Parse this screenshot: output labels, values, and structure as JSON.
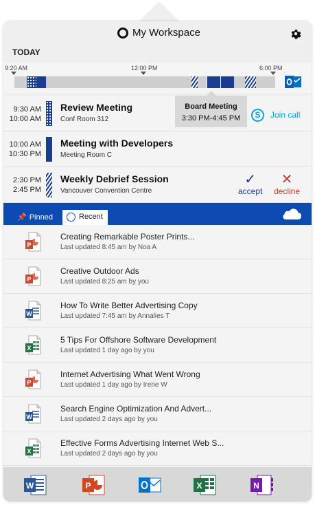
{
  "header": {
    "title": "My Workspace"
  },
  "today_label": "TODAY",
  "timeline": {
    "start_label": "9:20 AM",
    "mid_label": "12:00 PM",
    "end_label": "6:00 PM"
  },
  "meetings": [
    {
      "start": "9:30 AM",
      "end": "10:00 AM",
      "title": "Review Meeting",
      "location": "Conf Room 312",
      "pattern": "dots"
    },
    {
      "start": "10:00 AM",
      "end": "10:30 PM",
      "title": "Meeting with Developers",
      "location": "Meeting Room C",
      "pattern": "solid"
    },
    {
      "start": "2:30 PM",
      "end": "2:45 PM",
      "title": "Weekly Debrief Session",
      "location": "Vancouver Convention Centre",
      "pattern": "stripes"
    }
  ],
  "tooltip": {
    "title": "Board Meeting",
    "time": "3:30 PM-4:45 PM"
  },
  "join_call": {
    "label": "Join call",
    "icon": "skype-icon"
  },
  "rsvp": {
    "accept_label": "accept",
    "decline_label": "decline",
    "accept_color": "#1a3d8f",
    "decline_color": "#c0392b"
  },
  "tabs": {
    "pinned_label": "Pinned",
    "recent_label": "Recent"
  },
  "files": [
    {
      "app": "powerpoint",
      "title": "Creating Remarkable Poster Prints...",
      "meta": "Last updated 8:45 am by Noa A"
    },
    {
      "app": "powerpoint",
      "title": "Creative Outdoor Ads",
      "meta": "Last updated 8:25 am by you"
    },
    {
      "app": "word",
      "title": "How To Write Better Advertising Copy",
      "meta": "Last updated 7:45 am by Annalies T"
    },
    {
      "app": "excel",
      "title": "5 Tips For Offshore Software Development",
      "meta": "Last updated 1 day ago by you"
    },
    {
      "app": "powerpoint",
      "title": "Internet Advertising What Went Wrong",
      "meta": "Last updated 1 day ago by Irene W"
    },
    {
      "app": "word",
      "title": "Search Engine Optimization And Advert...",
      "meta": "Last updated 2 days ago by you"
    },
    {
      "app": "excel",
      "title": "Effective Forms Advertising Internet Web S...",
      "meta": "Last updated 2 days ago by you"
    }
  ],
  "dock": [
    "word-app-icon",
    "powerpoint-app-icon",
    "outlook-app-icon",
    "excel-app-icon",
    "onenote-app-icon"
  ],
  "colors": {
    "accent": "#0d4bb3",
    "navy": "#1a3d8f",
    "skype": "#00a8e6",
    "word": "#2b579a",
    "powerpoint": "#d24726",
    "excel": "#217346",
    "onenote": "#7719aa",
    "outlook": "#0072c6"
  }
}
